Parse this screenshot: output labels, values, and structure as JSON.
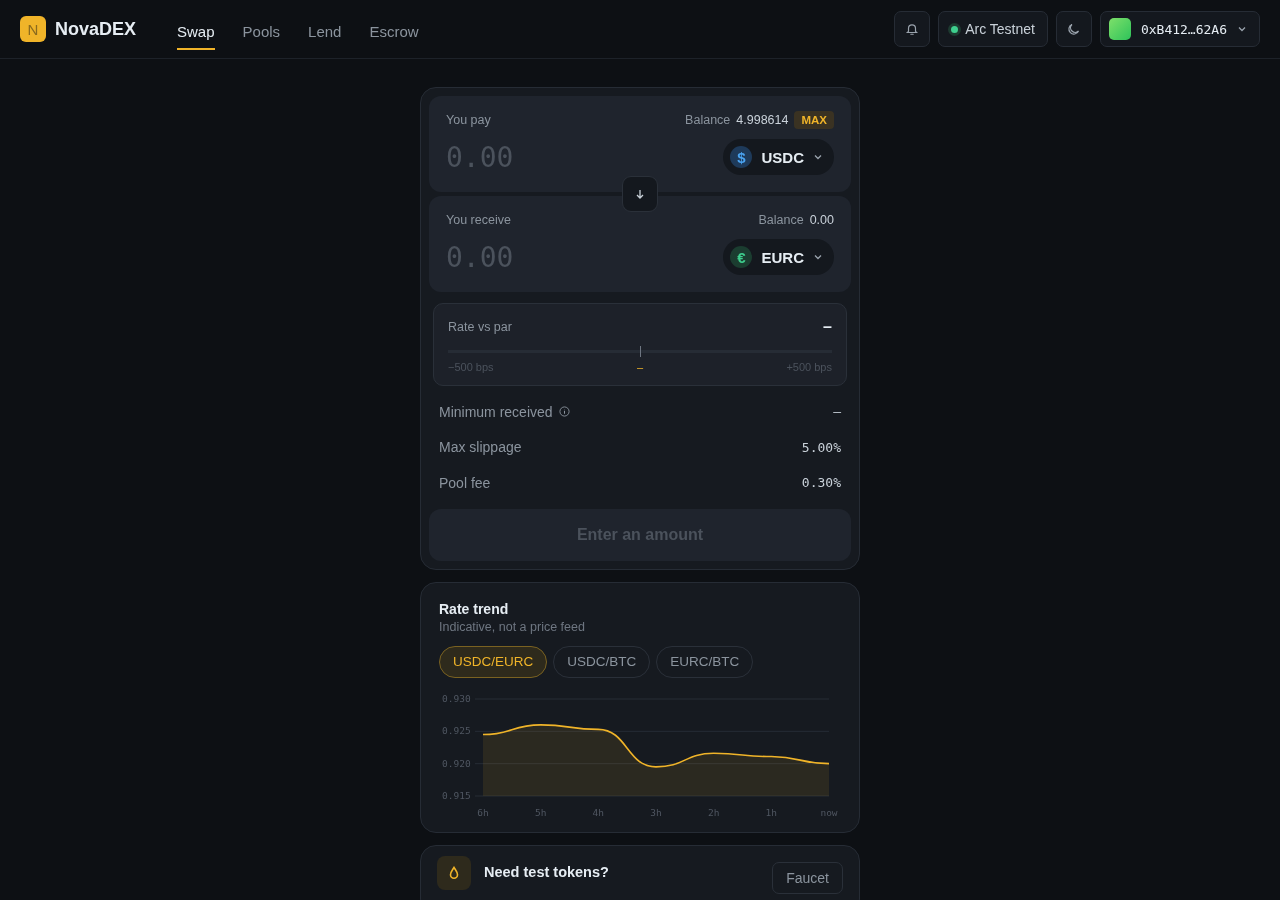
{
  "app": {
    "logo_letter": "N",
    "name": "NovaDEX"
  },
  "nav": [
    {
      "label": "Swap",
      "selected": true
    },
    {
      "label": "Pools",
      "selected": false
    },
    {
      "label": "Lend",
      "selected": false
    },
    {
      "label": "Escrow",
      "selected": false
    }
  ],
  "network": {
    "label": "Arc Testnet",
    "online": true
  },
  "wallet": {
    "address": "0xB412…62A6"
  },
  "swap": {
    "pay": {
      "label": "You pay",
      "balance_label": "Balance",
      "balance": "4.998614",
      "max": "MAX",
      "amount_placeholder": "0.00",
      "token": {
        "symbol": "USDC",
        "icon": "$"
      }
    },
    "receive": {
      "label": "You receive",
      "balance_label": "Balance",
      "balance": "0.00",
      "amount_placeholder": "0.00",
      "token": {
        "symbol": "EURC",
        "icon": "€"
      }
    },
    "rate_vs_par": {
      "label": "Rate vs par",
      "value": "–",
      "min_label": "−500 bps",
      "center_label": "–",
      "max_label": "+500 bps"
    },
    "details": [
      {
        "label": "Minimum received",
        "info": true,
        "value": "–"
      },
      {
        "label": "Max slippage",
        "info": false,
        "value": "5.00%"
      },
      {
        "label": "Pool fee",
        "info": false,
        "value": "0.30%"
      }
    ],
    "submit": {
      "label": "Enter an amount",
      "disabled": true
    }
  },
  "rate_trend": {
    "title": "Rate trend",
    "subtitle": "Indicative, not a price feed",
    "pairs": [
      {
        "label": "USDC/EURC",
        "selected": true
      },
      {
        "label": "USDC/BTC",
        "selected": false
      },
      {
        "label": "EURC/BTC",
        "selected": false
      }
    ],
    "chart_data": {
      "type": "area",
      "categories": [
        "6h",
        "5h",
        "4h",
        "3h",
        "2h",
        "1h",
        "now"
      ],
      "series": [
        {
          "color": "#f0b429",
          "values": [
            0.9245,
            0.926,
            0.9253,
            0.9195,
            0.9216,
            0.9211,
            0.92
          ]
        }
      ],
      "ylim": [
        0.915,
        0.93
      ],
      "yticks": [
        {
          "value": 0.915,
          "label": "0.915"
        },
        {
          "value": 0.92,
          "label": "0.920"
        },
        {
          "value": 0.925,
          "label": "0.925"
        },
        {
          "value": 0.93,
          "label": "0.930"
        }
      ]
    }
  },
  "faucet": {
    "title": "Need test tokens?",
    "button": "Faucet"
  }
}
